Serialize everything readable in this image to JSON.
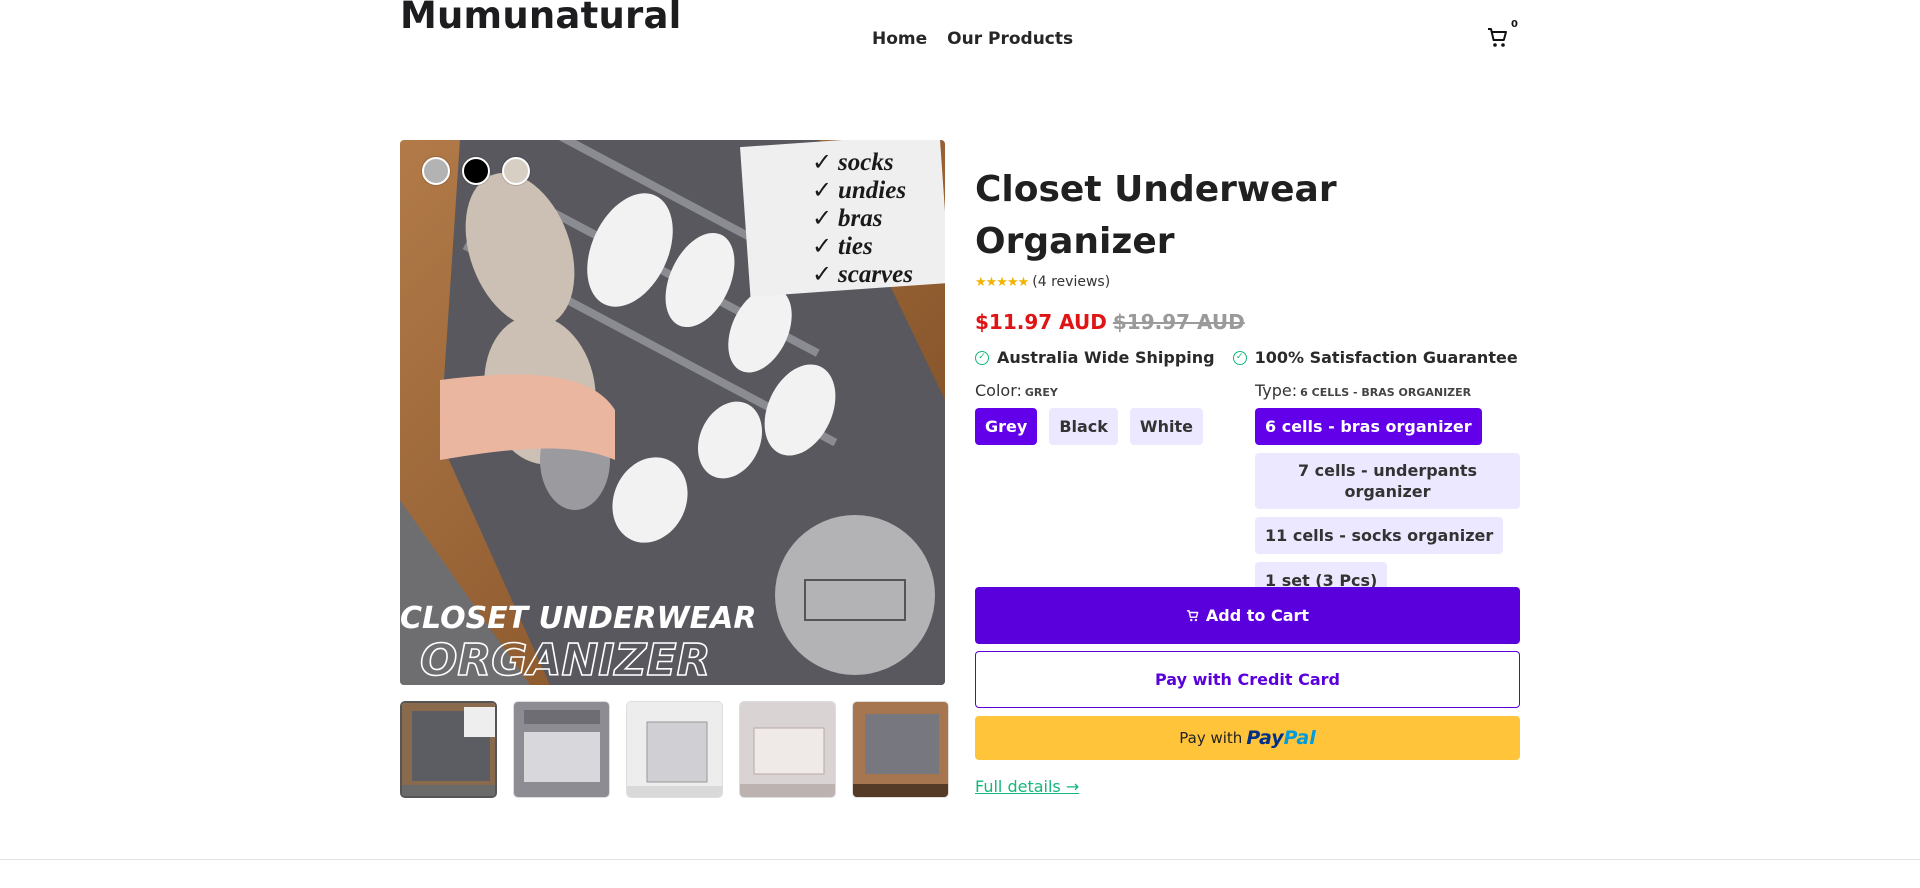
{
  "header": {
    "brand": "Mumunatural",
    "nav": [
      {
        "label": "Home"
      },
      {
        "label": "Our Products"
      }
    ],
    "cart_count": "0"
  },
  "product": {
    "title": "Closet Underwear Organizer",
    "rating": 5,
    "reviews": "(4 reviews)",
    "price": "$11.97 AUD",
    "compare_price": "$19.97 AUD",
    "badges": [
      {
        "label": "Australia Wide Shipping",
        "icon": "check-circle-icon"
      },
      {
        "label": "100% Satisfaction Guarantee",
        "icon": "check-circle-icon"
      }
    ],
    "image_text": {
      "checklist": [
        "socks",
        "undies",
        "bras",
        "ties",
        "scarves"
      ],
      "line1": "CLOSET UNDERWEAR",
      "line2": "ORGANIZER"
    },
    "color_dots": [
      {
        "color": "#b3b3b3"
      },
      {
        "color": "#000000"
      },
      {
        "color": "#d8cfc4"
      }
    ],
    "thumbnails": 5
  },
  "options": {
    "color": {
      "label": "Color:",
      "selected": "GREY",
      "values": [
        "Grey",
        "Black",
        "White"
      ],
      "active_index": 0
    },
    "type": {
      "label": "Type:",
      "selected": "6 CELLS - BRAS ORGANIZER",
      "values": [
        "6 cells - bras organizer",
        "7 cells - underpants organizer",
        "11 cells - socks organizer",
        "1 set (3 Pcs)"
      ],
      "active_index": 0
    }
  },
  "actions": {
    "add_to_cart": "Add to Cart",
    "pay_card": "Pay with Credit Card",
    "paypal_prefix": "Pay with",
    "paypal_brand_1": "Pay",
    "paypal_brand_2": "Pal",
    "full_details": "Full details",
    "full_details_arrow": "→"
  },
  "colors": {
    "accent": "#5a00dc",
    "chip_bg": "#ece8ff",
    "price": "#e01414",
    "success": "#14b87a",
    "paypal": "#ffc439",
    "stars": "#f1b400"
  }
}
